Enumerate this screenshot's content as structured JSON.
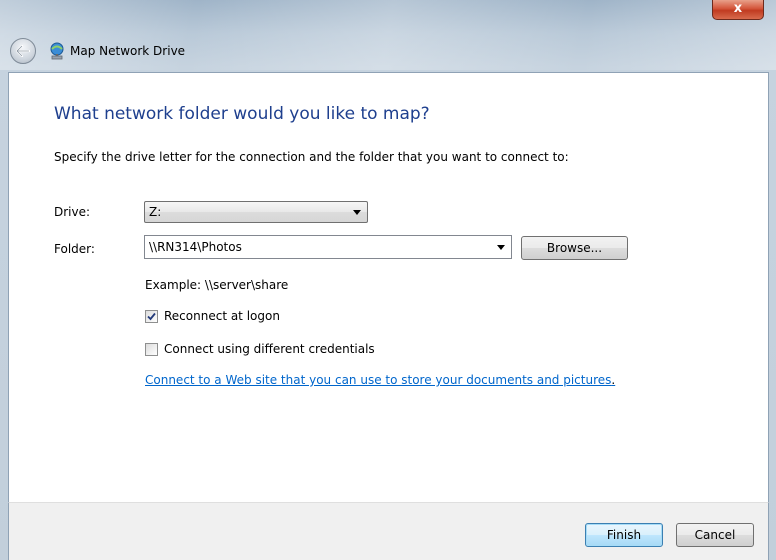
{
  "window": {
    "title": "Map Network Drive",
    "close_glyph": "x"
  },
  "wizard": {
    "heading": "What network folder would you like to map?",
    "instructions": "Specify the drive letter for the connection and the folder that you want to connect to:"
  },
  "drive": {
    "label": "Drive:",
    "selected": "Z:"
  },
  "folder": {
    "label": "Folder:",
    "value": "\\\\RN314\\Photos",
    "browse_label": "Browse...",
    "example": "Example: \\\\server\\share"
  },
  "options": {
    "reconnect": {
      "label": "Reconnect at logon",
      "checked": true
    },
    "different_credentials": {
      "label": "Connect using different credentials",
      "checked": false
    }
  },
  "link": {
    "text": "Connect to a Web site that you can use to store your documents and pictures",
    "trailing": "."
  },
  "footer": {
    "finish_label": "Finish",
    "cancel_label": "Cancel"
  },
  "icons": {
    "back": "back-arrow-icon",
    "title": "network-drive-icon",
    "close": "close-icon",
    "checkmark": "checkmark-icon",
    "dropdown": "chevron-down-icon"
  },
  "colors": {
    "heading": "#1e3f8e",
    "link": "#0066cc",
    "close_button": "#c03b21"
  }
}
